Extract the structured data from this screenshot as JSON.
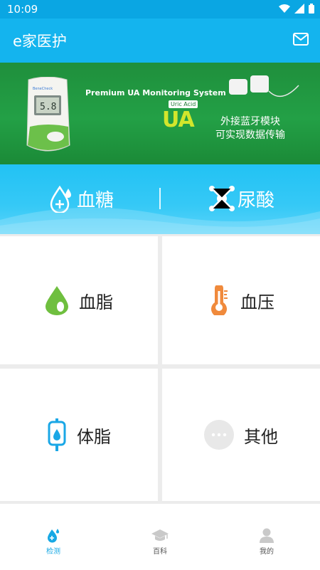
{
  "status_bar": {
    "time": "10:09"
  },
  "app_bar": {
    "title": "e家医护",
    "mail_icon": "mail-icon"
  },
  "banner": {
    "headline": "Premium UA Monitoring System",
    "tag": "Uric Acid",
    "badge": "UA",
    "line1": "外接蓝牙模块",
    "line2": "可实现数据传输"
  },
  "primary_tests": [
    {
      "label": "血糖",
      "icon": "blood-drop-plus-icon"
    },
    {
      "label": "尿酸",
      "icon": "molecule-icon"
    }
  ],
  "tests": [
    {
      "label": "血脂",
      "icon": "green-drop-icon",
      "color": "#6fbf3f"
    },
    {
      "label": "血压",
      "icon": "thermometer-icon",
      "color": "#f08a3c"
    },
    {
      "label": "体脂",
      "icon": "iv-bag-icon",
      "color": "#1aa7e6"
    },
    {
      "label": "其他",
      "icon": "more-dots-icon",
      "color": "#e8e8e8"
    }
  ],
  "tab_bar": {
    "items": [
      {
        "label": "检测",
        "icon": "detect-icon",
        "active": true
      },
      {
        "label": "百科",
        "icon": "graduation-cap-icon",
        "active": false
      },
      {
        "label": "我的",
        "icon": "person-icon",
        "active": false
      }
    ]
  },
  "colors": {
    "primary": "#14b4ee",
    "active_tab": "#16a8e4"
  }
}
